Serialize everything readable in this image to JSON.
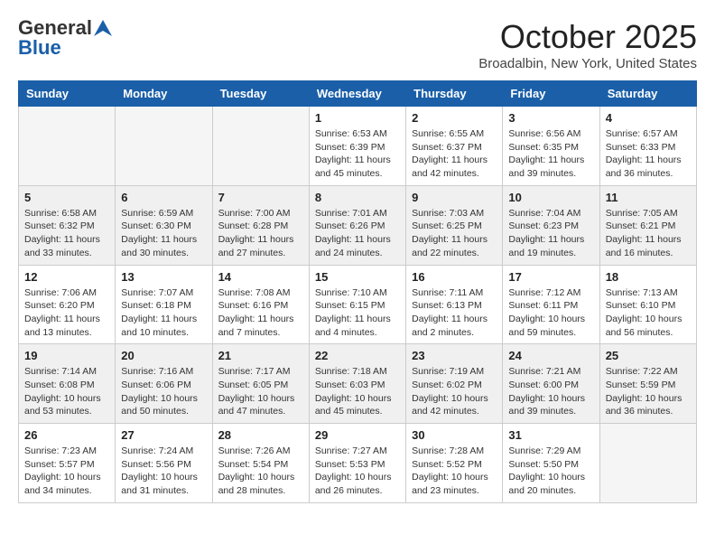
{
  "header": {
    "logo_line1": "General",
    "logo_line2": "Blue",
    "month": "October 2025",
    "location": "Broadalbin, New York, United States"
  },
  "days_of_week": [
    "Sunday",
    "Monday",
    "Tuesday",
    "Wednesday",
    "Thursday",
    "Friday",
    "Saturday"
  ],
  "weeks": [
    [
      {
        "day": "",
        "empty": true
      },
      {
        "day": "",
        "empty": true
      },
      {
        "day": "",
        "empty": true
      },
      {
        "day": "1",
        "sunrise": "6:53 AM",
        "sunset": "6:39 PM",
        "daylight": "11 hours and 45 minutes."
      },
      {
        "day": "2",
        "sunrise": "6:55 AM",
        "sunset": "6:37 PM",
        "daylight": "11 hours and 42 minutes."
      },
      {
        "day": "3",
        "sunrise": "6:56 AM",
        "sunset": "6:35 PM",
        "daylight": "11 hours and 39 minutes."
      },
      {
        "day": "4",
        "sunrise": "6:57 AM",
        "sunset": "6:33 PM",
        "daylight": "11 hours and 36 minutes."
      }
    ],
    [
      {
        "day": "5",
        "sunrise": "6:58 AM",
        "sunset": "6:32 PM",
        "daylight": "11 hours and 33 minutes."
      },
      {
        "day": "6",
        "sunrise": "6:59 AM",
        "sunset": "6:30 PM",
        "daylight": "11 hours and 30 minutes."
      },
      {
        "day": "7",
        "sunrise": "7:00 AM",
        "sunset": "6:28 PM",
        "daylight": "11 hours and 27 minutes."
      },
      {
        "day": "8",
        "sunrise": "7:01 AM",
        "sunset": "6:26 PM",
        "daylight": "11 hours and 24 minutes."
      },
      {
        "day": "9",
        "sunrise": "7:03 AM",
        "sunset": "6:25 PM",
        "daylight": "11 hours and 22 minutes."
      },
      {
        "day": "10",
        "sunrise": "7:04 AM",
        "sunset": "6:23 PM",
        "daylight": "11 hours and 19 minutes."
      },
      {
        "day": "11",
        "sunrise": "7:05 AM",
        "sunset": "6:21 PM",
        "daylight": "11 hours and 16 minutes."
      }
    ],
    [
      {
        "day": "12",
        "sunrise": "7:06 AM",
        "sunset": "6:20 PM",
        "daylight": "11 hours and 13 minutes."
      },
      {
        "day": "13",
        "sunrise": "7:07 AM",
        "sunset": "6:18 PM",
        "daylight": "11 hours and 10 minutes."
      },
      {
        "day": "14",
        "sunrise": "7:08 AM",
        "sunset": "6:16 PM",
        "daylight": "11 hours and 7 minutes."
      },
      {
        "day": "15",
        "sunrise": "7:10 AM",
        "sunset": "6:15 PM",
        "daylight": "11 hours and 4 minutes."
      },
      {
        "day": "16",
        "sunrise": "7:11 AM",
        "sunset": "6:13 PM",
        "daylight": "11 hours and 2 minutes."
      },
      {
        "day": "17",
        "sunrise": "7:12 AM",
        "sunset": "6:11 PM",
        "daylight": "10 hours and 59 minutes."
      },
      {
        "day": "18",
        "sunrise": "7:13 AM",
        "sunset": "6:10 PM",
        "daylight": "10 hours and 56 minutes."
      }
    ],
    [
      {
        "day": "19",
        "sunrise": "7:14 AM",
        "sunset": "6:08 PM",
        "daylight": "10 hours and 53 minutes."
      },
      {
        "day": "20",
        "sunrise": "7:16 AM",
        "sunset": "6:06 PM",
        "daylight": "10 hours and 50 minutes."
      },
      {
        "day": "21",
        "sunrise": "7:17 AM",
        "sunset": "6:05 PM",
        "daylight": "10 hours and 47 minutes."
      },
      {
        "day": "22",
        "sunrise": "7:18 AM",
        "sunset": "6:03 PM",
        "daylight": "10 hours and 45 minutes."
      },
      {
        "day": "23",
        "sunrise": "7:19 AM",
        "sunset": "6:02 PM",
        "daylight": "10 hours and 42 minutes."
      },
      {
        "day": "24",
        "sunrise": "7:21 AM",
        "sunset": "6:00 PM",
        "daylight": "10 hours and 39 minutes."
      },
      {
        "day": "25",
        "sunrise": "7:22 AM",
        "sunset": "5:59 PM",
        "daylight": "10 hours and 36 minutes."
      }
    ],
    [
      {
        "day": "26",
        "sunrise": "7:23 AM",
        "sunset": "5:57 PM",
        "daylight": "10 hours and 34 minutes."
      },
      {
        "day": "27",
        "sunrise": "7:24 AM",
        "sunset": "5:56 PM",
        "daylight": "10 hours and 31 minutes."
      },
      {
        "day": "28",
        "sunrise": "7:26 AM",
        "sunset": "5:54 PM",
        "daylight": "10 hours and 28 minutes."
      },
      {
        "day": "29",
        "sunrise": "7:27 AM",
        "sunset": "5:53 PM",
        "daylight": "10 hours and 26 minutes."
      },
      {
        "day": "30",
        "sunrise": "7:28 AM",
        "sunset": "5:52 PM",
        "daylight": "10 hours and 23 minutes."
      },
      {
        "day": "31",
        "sunrise": "7:29 AM",
        "sunset": "5:50 PM",
        "daylight": "10 hours and 20 minutes."
      },
      {
        "day": "",
        "empty": true
      }
    ]
  ]
}
